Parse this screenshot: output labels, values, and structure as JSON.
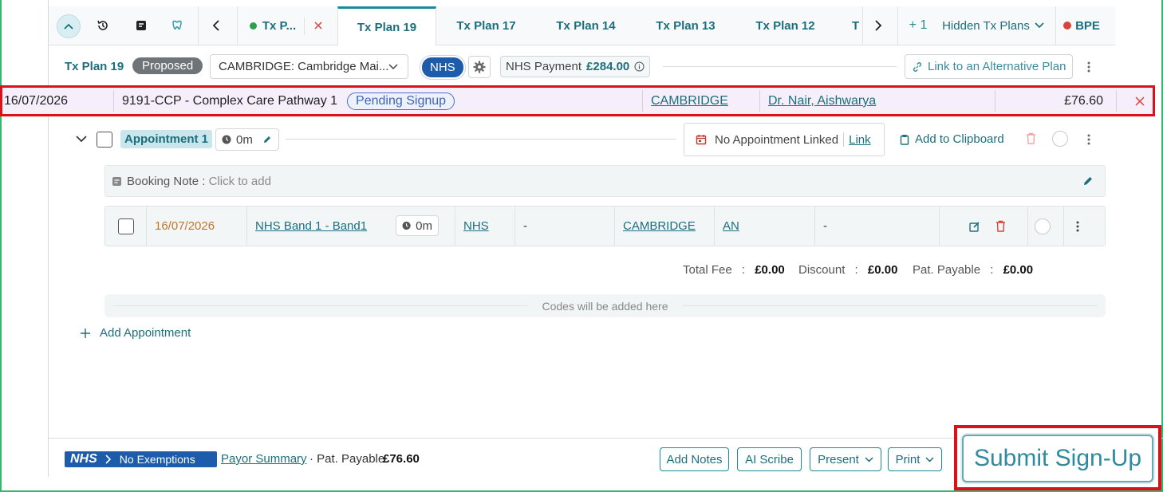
{
  "tabs": {
    "first_tab": "Tx P...",
    "items": [
      "Tx Plan 19",
      "Tx Plan 17",
      "Tx Plan 14",
      "Tx Plan 13",
      "Tx Plan 12"
    ],
    "truncated_next": "T",
    "plus_count": "+ 1",
    "hidden": "Hidden Tx Plans",
    "bpe": "BPE"
  },
  "plan": {
    "name": "Tx Plan 19",
    "status": "Proposed",
    "location": "CAMBRIDGE: Cambridge Mai...",
    "payor": "NHS",
    "payment_label": "NHS Payment",
    "payment_amount": "£284.00",
    "alt_plan_link": "Link to an Alternative Plan"
  },
  "highlight_row": {
    "date": "16/07/2026",
    "treatment": "9191-CCP - Complex Care Pathway 1",
    "badge": "Pending Signup",
    "location": "CAMBRIDGE",
    "provider": "Dr. Nair, Aishwarya",
    "fee": "£76.60"
  },
  "appointment": {
    "label": "Appointment 1",
    "duration": "0m",
    "no_linked": "No Appointment Linked",
    "link": "Link",
    "clipboard": "Add to Clipboard",
    "booking_label": "Booking Note",
    "booking_sep": " : ",
    "booking_placeholder": "Click to add"
  },
  "item_row": {
    "date": "16/07/2026",
    "band": "NHS Band 1 - Band1",
    "duration": "0m",
    "payor": "NHS",
    "dash1": "-",
    "location": "CAMBRIDGE",
    "provider": "AN",
    "dash2": "-"
  },
  "totals": {
    "total_fee_label": "Total Fee",
    "total_fee": "£0.00",
    "discount_label": "Discount",
    "discount": "£0.00",
    "pat_payable_label": "Pat. Payable",
    "pat_payable": "£0.00",
    "colon": ":"
  },
  "codes_placeholder": "Codes will be added here",
  "add_appointment": "Add Appointment",
  "footer": {
    "nhs": "NHS",
    "exemption": "No Exemptions",
    "payor_summary": "Payor Summary",
    "pat_payable_label": "· Pat. Payable",
    "pat_payable": "£76.60",
    "add_notes": "Add Notes",
    "ai_scribe": "AI Scribe",
    "present": "Present",
    "print": "Print",
    "submit": "Submit Sign-Up"
  },
  "colors": {
    "teal": "#1b6f7d",
    "highlight_border": "#d9121a",
    "nhs_blue": "#1c5cab"
  }
}
